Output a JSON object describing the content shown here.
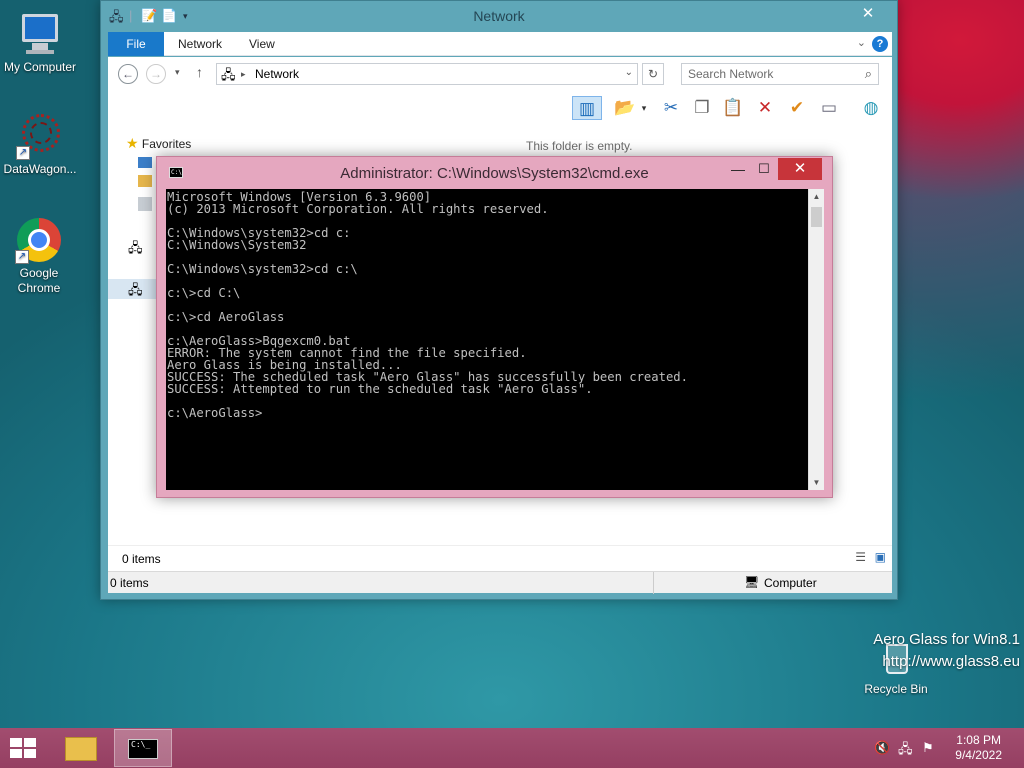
{
  "desktop": {
    "icons": [
      {
        "label": "My Computer"
      },
      {
        "label": "DataWagon..."
      },
      {
        "label": "Google Chrome"
      }
    ],
    "recycle_bin": "Recycle Bin",
    "watermark": {
      "line1": "Aero Glass for Win8.1",
      "line2": "http://www.glass8.eu"
    }
  },
  "explorer": {
    "title": "Network",
    "close_glyph": "✕",
    "tabs": [
      "File",
      "Network",
      "View"
    ],
    "help_glyph": "?",
    "address_text": "Network",
    "search_placeholder": "Search Network",
    "nav_favorites": "Favorites",
    "empty_message": "This folder is empty.",
    "status_items_top": "0 items",
    "status_items_bottom": "0 items",
    "status_location": "Computer"
  },
  "cmd": {
    "title": "Administrator: C:\\Windows\\System32\\cmd.exe",
    "lines": [
      "Microsoft Windows [Version 6.3.9600]",
      "(c) 2013 Microsoft Corporation. All rights reserved.",
      "",
      "C:\\Windows\\system32>cd c:",
      "C:\\Windows\\System32",
      "",
      "C:\\Windows\\system32>cd c:\\",
      "",
      "c:\\>cd C:\\",
      "",
      "c:\\>cd AeroGlass",
      "",
      "c:\\AeroGlass>Bqgexcm0.bat",
      "ERROR: The system cannot find the file specified.",
      "Aero Glass is being installed...",
      "SUCCESS: The scheduled task \"Aero Glass\" has successfully been created.",
      "SUCCESS: Attempted to run the scheduled task \"Aero Glass\".",
      "",
      "c:\\AeroGlass>"
    ]
  },
  "taskbar": {
    "time": "1:08 PM",
    "date": "9/4/2022"
  },
  "colors": {
    "taskbar": "#9c4668",
    "cmd_frame": "#e5a7bf",
    "explorer_frame": "#5fa7b8",
    "file_tab": "#1979ca",
    "close_button": "#c7343a"
  }
}
